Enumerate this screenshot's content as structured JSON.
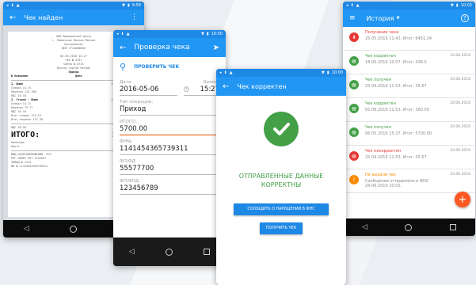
{
  "colors": {
    "primary": "#2196f3",
    "success": "#43a047",
    "error": "#e53935",
    "warning": "#fb8c00",
    "fab": "#ff5722"
  },
  "status": {
    "time1": "9:58",
    "time2": "10:00",
    "time3": "10:00",
    "time4": "10:02"
  },
  "screen1": {
    "title": "Чек найден",
    "receipt": {
      "header": [
        "ООО Медицинский Центр",
        "г. Раменское Москва Москва",
        "Центральная",
        "ИНН 7714000000",
        "",
        "06.05.2016 15:27",
        "Чек № 4131",
        "Смена № 0734",
        "Кассир Сергей Петров"
      ],
      "type": "Приход",
      "cols": [
        "№ Название",
        "Цена",
        "Кол."
      ],
      "items": [
        [
          "1. Лыжи",
          "3,870.00",
          "127.75"
        ],
        [
          "   Скидка 14.1%",
          "",
          ""
        ],
        [
          "   Наценка 115.700",
          "",
          ""
        ],
        [
          "   НДС 18.18",
          "",
          ""
        ],
        [
          "2. Сторно - Лыжи",
          "3,870.00",
          "127.75"
        ],
        [
          "   Скидка 14.1%",
          "",
          ""
        ],
        [
          "   Наценка 75.77",
          "",
          ""
        ],
        [
          "   НДС 18.18",
          "",
          ""
        ]
      ],
      "subtotals": [
        "Итог скидок 123.19",
        "Итог наценок 112.38"
      ],
      "vat_line": "НДС 18.18",
      "total_label": "ИТОГО:",
      "total_value": "5,700",
      "payments": [
        "Наличные",
        "Карта"
      ],
      "footer": [
        "ВИД НАЛОГООБЛОЖЕНИЯ: УСН",
        "РЕГ НОМЕР ККТ 1234567",
        "ЗАВОД №  1213",
        "ФН № 11415454365739311"
      ]
    }
  },
  "screen2": {
    "title": "Проверка чека",
    "verify_button": "ПРОВЕРИТЬ ЧЕК",
    "date_label": "Дата:",
    "date_value": "2016-05-06",
    "time_label": "Время:",
    "time_value": "15:27",
    "op_label": "Тип операции:",
    "op_value": "Приход",
    "sum_label": "ИТОГО:",
    "sum_value": "5700.00",
    "fn_label": "ФН№:",
    "fn_value": "1141454365739311",
    "fd_label": "ФП/ФД:",
    "fd_value": "55577700",
    "fp_label": "ФП/ФПД:",
    "fp_value": "123456789"
  },
  "screen3": {
    "title": "Чек корректен",
    "message": "ОТПРАВЛЕННЫЕ ДАННЫЕ КОРРЕКТНЫ",
    "report_button": "СООБЩИТЬ О НАРУШЕНИИ В ФНС",
    "get_button": "ПОЛУЧИТЬ ЧЕК"
  },
  "screen4": {
    "title": "История",
    "items": [
      {
        "icon": "⬇",
        "color": "#e53935",
        "title": "Получение чека",
        "sub": "25.05.2016 11:43. Итог: 6451.24",
        "date": ""
      },
      {
        "icon": "▤",
        "color": "#43a047",
        "title": "Чек корректен",
        "sub": "18.05.2016 10:07. Итог: 436.0",
        "date": "24.06.2016"
      },
      {
        "icon": "▤",
        "color": "#43a047",
        "title": "Чек получен",
        "sub": "25.04.2016 11:53. Итог: 35.67",
        "date": "24.06.2016"
      },
      {
        "icon": "▤",
        "color": "#43a047",
        "title": "Чек корректен",
        "sub": "02.06.2016 11:53. Итог: 360.00",
        "date": "24.06.2016"
      },
      {
        "icon": "▤",
        "color": "#43a047",
        "title": "Чек получен",
        "sub": "06.05.2016 15:27. Итог: 5700.00",
        "date": "24.06.2016"
      },
      {
        "icon": "▤",
        "color": "#e53935",
        "title": "Чек некорректен",
        "sub": "25.04.2016 11:53. Итог: 35.67",
        "date": "24.06.2016"
      },
      {
        "icon": "!",
        "color": "#fb8c00",
        "title": "Не выдали чек",
        "sub": "Сообщение отправлено в ФНС\n24.06.2016 10:02.",
        "date": "24.06.2016"
      }
    ]
  }
}
